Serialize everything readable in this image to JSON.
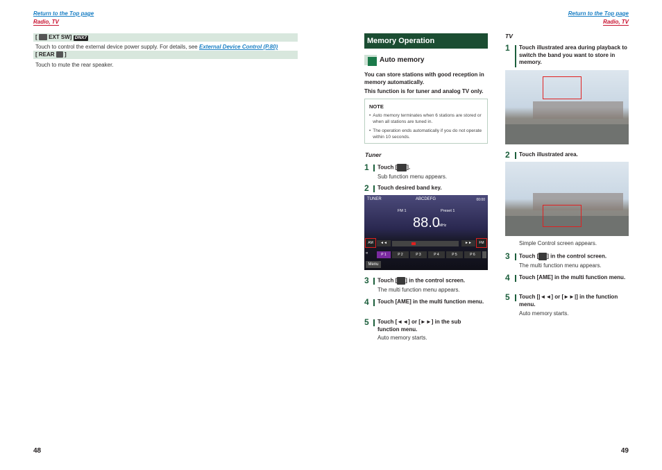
{
  "left": {
    "top_link": "Return to the Top page",
    "sub_link": "Radio, TV",
    "ext_sw": {
      "open": "[",
      "label": "EXT SW]",
      "badge": "DNX7",
      "desc": "Touch to control the external device power supply. For details, see",
      "link": "External Device Control (P.80)"
    },
    "rear": {
      "label": "[ REAR",
      "close": "]",
      "desc": "Touch to mute the rear speaker."
    },
    "page_number": "48"
  },
  "right": {
    "top_link": "Return to the Top page",
    "sub_link": "Radio, TV",
    "section_title": "Memory Operation",
    "subsection_title": "Auto memory",
    "intro1": "You can store stations with good reception in memory automatically.",
    "intro2": "This function is for tuner and analog TV only.",
    "note": {
      "title": "NOTE",
      "items": [
        "Auto memory terminates when 6 stations are stored or when all stations are tuned in.",
        "The operation ends automatically if you do not operate within 10 seconds."
      ]
    },
    "tuner": {
      "heading": "Tuner",
      "steps": [
        {
          "num": "1",
          "pre": "Touch [",
          "post": "].",
          "sub": "Sub function menu appears."
        },
        {
          "num": "2",
          "text": "Touch desired band key."
        },
        {
          "num": "3",
          "pre": "Touch [",
          "post": "] in the control screen.",
          "sub": "The multi function menu appears."
        },
        {
          "num": "4",
          "text": "Touch [AME] in the multi function menu."
        },
        {
          "num": "5",
          "text": "Touch [◄◄] or [►►] in the sub function menu.",
          "sub": "Auto memory starts."
        }
      ],
      "screen": {
        "source": "TUNER",
        "name": "ABCDEFG",
        "clock": "00:00",
        "band": "FM 1",
        "preset": "Preset 1",
        "freq": "88.0",
        "unit": "MHz",
        "am_key": "AM",
        "fm_key": "FM",
        "prev_key": "◄◄",
        "next_key": "►►",
        "presets": [
          "P 1",
          "P 2",
          "P 3",
          "P 4",
          "P 5",
          "P 6"
        ],
        "menu": "Menu"
      }
    },
    "tv": {
      "heading": "TV",
      "steps": [
        {
          "num": "1",
          "text": "Touch illustrated area during playback to switch the band you want to store in memory."
        },
        {
          "num": "2",
          "text": "Touch illustrated area.",
          "sub": "Simple Control screen appears."
        },
        {
          "num": "3",
          "pre": "Touch [",
          "post": "] in the control screen.",
          "sub": "The multi function menu appears."
        },
        {
          "num": "4",
          "text": "Touch [AME] in the multi function menu."
        },
        {
          "num": "5",
          "text": "Touch [|◄◄] or [►►|] in the function menu.",
          "sub": "Auto memory starts."
        }
      ]
    },
    "page_number": "49"
  },
  "colors": {
    "link_blue": "#1a7fc4",
    "link_red": "#c8102e",
    "section_green": "#1b4d32",
    "bar_green": "#d8e7dd",
    "highlight_red": "#e02020"
  }
}
